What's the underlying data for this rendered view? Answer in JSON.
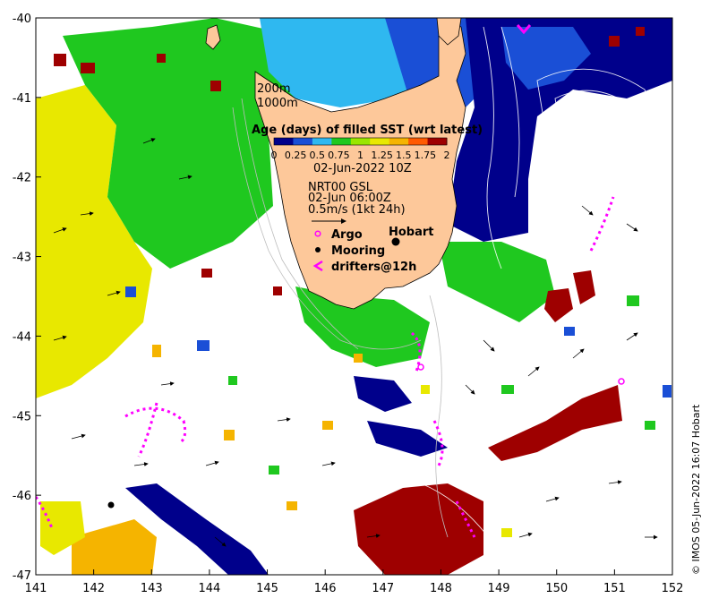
{
  "map": {
    "lon_range": [
      141,
      152
    ],
    "lat_range": [
      -47,
      -40
    ],
    "x_ticks": [
      "141",
      "142",
      "143",
      "144",
      "145",
      "146",
      "147",
      "148",
      "149",
      "150",
      "151",
      "152"
    ],
    "y_ticks": [
      "-40",
      "-41",
      "-42",
      "-43",
      "-44",
      "-45",
      "-46",
      "-47"
    ],
    "background": "#ffffff",
    "land_color": "#fdc89a",
    "colors": {
      "darkred": "#9e0000",
      "navy": "#00008b",
      "blue": "#1a4fd6",
      "cyan": "#2fb8f0",
      "green": "#1fc81f",
      "yellow": "#e8e800",
      "orange": "#f5b400",
      "argo": "#ff00ff"
    }
  },
  "depth_labels": {
    "d200": "200m",
    "d1000": "1000m"
  },
  "colorbar": {
    "title": "Age (days) of filled SST (wrt latest)",
    "ticks": [
      "0",
      "0.25",
      "0.5",
      "0.75",
      "1",
      "1.25",
      "1.5",
      "1.75",
      "2"
    ],
    "colors": [
      "#00008b",
      "#1a4fd6",
      "#2fb8f0",
      "#1fc81f",
      "#9ae600",
      "#e8e800",
      "#f5b400",
      "#ff5a00",
      "#9e0000"
    ]
  },
  "info": {
    "date": "02-Jun-2022 10Z",
    "product": "NRT00 GSL",
    "time": "02-Jun 06:00Z",
    "scale": "0.5m/s (1kt 24h)"
  },
  "legend": {
    "argo": "Argo",
    "mooring": "Mooring",
    "drifters": "drifters@12h"
  },
  "places": {
    "hobart": "Hobart"
  },
  "credit": "© IMOS 05-Jun-2022 16:07 Hobart"
}
